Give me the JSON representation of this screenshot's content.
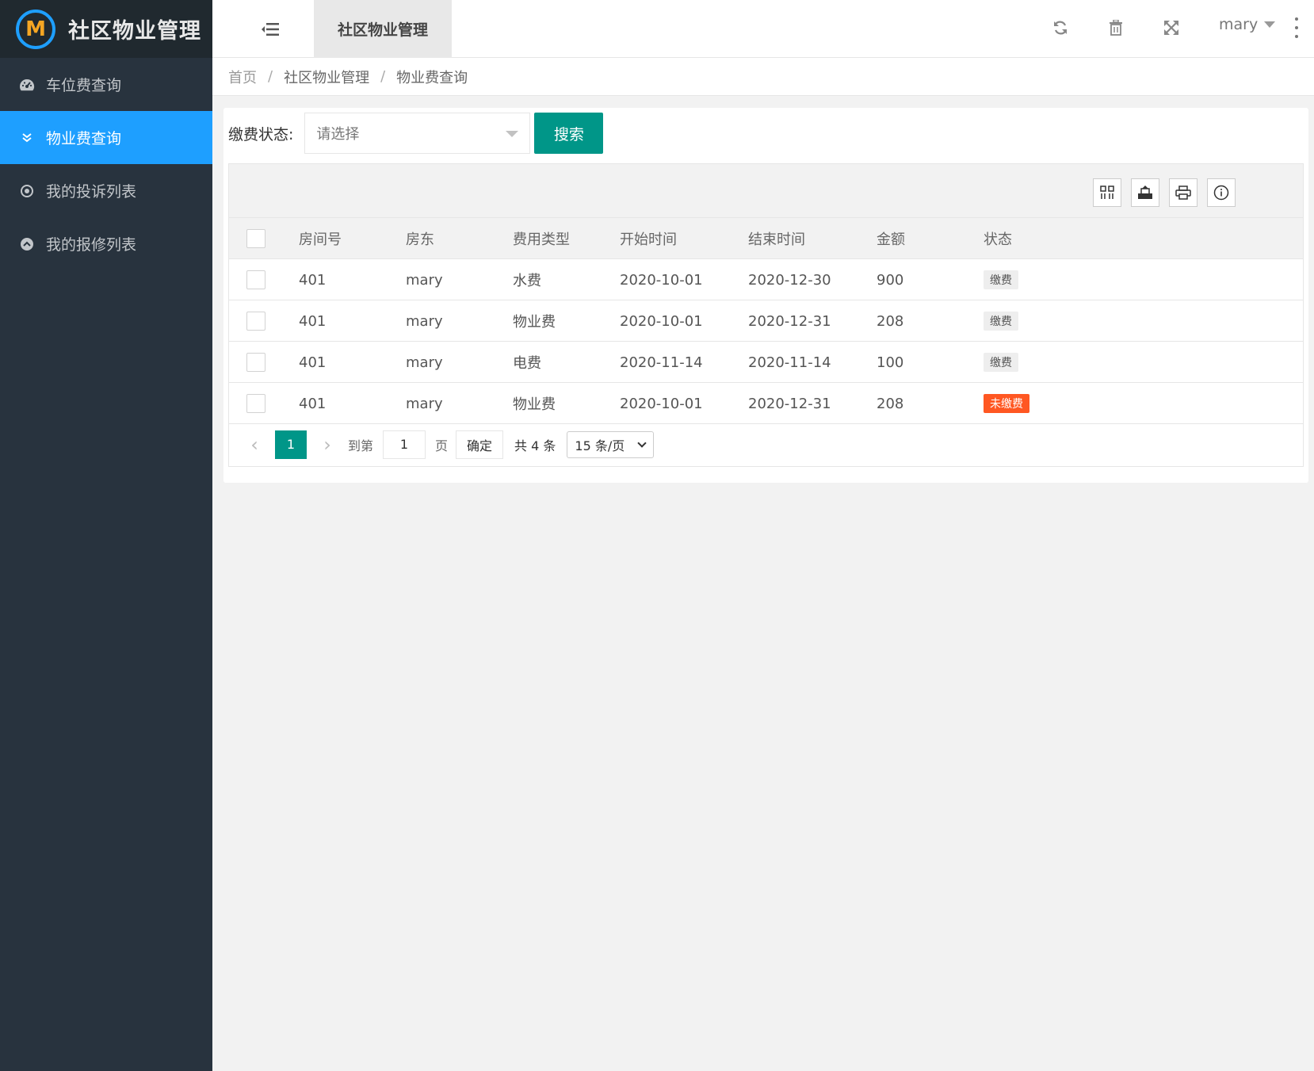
{
  "app": {
    "title": "社区物业管理",
    "logo_letter": "M"
  },
  "sidebar": {
    "items": [
      {
        "label": "车位费查询",
        "icon": "dashboard-icon"
      },
      {
        "label": "物业费查询",
        "icon": "double-chevron-down-icon",
        "active": true
      },
      {
        "label": "我的投诉列表",
        "icon": "target-icon"
      },
      {
        "label": "我的报修列表",
        "icon": "chevron-up-circle-icon"
      }
    ]
  },
  "header": {
    "active_tab": "社区物业管理",
    "user": "mary",
    "icons": [
      "menu-fold-icon",
      "refresh-icon",
      "trash-icon",
      "fullscreen-icon",
      "more-icon"
    ]
  },
  "breadcrumb": {
    "items": [
      "首页",
      "社区物业管理",
      "物业费查询"
    ],
    "separator": "/"
  },
  "filter": {
    "label": "缴费状态:",
    "placeholder": "请选择",
    "search_label": "搜索"
  },
  "table": {
    "toolbar_icons": [
      "columns-icon",
      "export-icon",
      "print-icon",
      "info-icon"
    ],
    "columns": [
      "房间号",
      "房东",
      "费用类型",
      "开始时间",
      "结束时间",
      "金额",
      "状态"
    ],
    "rows": [
      {
        "room": "401",
        "owner": "mary",
        "type": "水费",
        "start": "2020-10-01",
        "end": "2020-12-30",
        "amount": "900",
        "status": "缴费",
        "paid": true
      },
      {
        "room": "401",
        "owner": "mary",
        "type": "物业费",
        "start": "2020-10-01",
        "end": "2020-12-31",
        "amount": "208",
        "status": "缴费",
        "paid": true
      },
      {
        "room": "401",
        "owner": "mary",
        "type": "电费",
        "start": "2020-11-14",
        "end": "2020-11-14",
        "amount": "100",
        "status": "缴费",
        "paid": true
      },
      {
        "room": "401",
        "owner": "mary",
        "type": "物业费",
        "start": "2020-10-01",
        "end": "2020-12-31",
        "amount": "208",
        "status": "未缴费",
        "paid": false
      }
    ]
  },
  "pager": {
    "current": "1",
    "goto_label": "到第",
    "goto_value": "1",
    "page_unit": "页",
    "confirm": "确定",
    "total": "共 4 条",
    "page_size": "15 条/页"
  },
  "colors": {
    "sidebar_bg": "#28333e",
    "logo_bg": "#20292f",
    "active_blue": "#1e9fff",
    "primary_green": "#009688",
    "unpaid_orange": "#ff5722"
  }
}
